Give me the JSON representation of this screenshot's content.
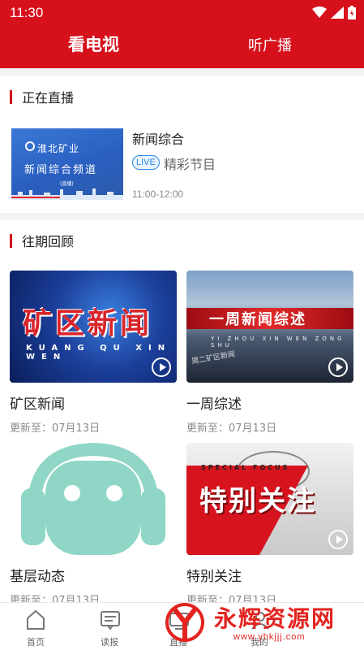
{
  "status_bar": {
    "time": "11:30"
  },
  "header": {
    "tabs": [
      {
        "label": "看电视",
        "active": true
      },
      {
        "label": "听广播",
        "active": false
      }
    ],
    "accent_color": "#d6111c"
  },
  "live_section": {
    "title": "正在直播",
    "item": {
      "title": "新闻综合",
      "badge": "LIVE",
      "program": "精彩节目",
      "time": "11:00-12:00",
      "thumb_logo": "淮北矿业",
      "thumb_channel": "新闻综合频道",
      "thumb_sub": "(直播)"
    }
  },
  "replay_section": {
    "title": "往期回顾",
    "items": [
      {
        "title": "矿区新闻",
        "update": "更新至：07月13日",
        "thumb_text": "矿区新闻",
        "thumb_pinyin": "KUANG QU XIN WEN",
        "icon": "play-icon"
      },
      {
        "title": "一周综述",
        "update": "更新至：07月13日",
        "thumb_text": "一周新闻综述",
        "thumb_pinyin": "YI ZHOU XIN WEN ZONG SHU",
        "thumb_caption": "周二矿区新闻",
        "icon": "play-icon"
      },
      {
        "title": "基层动态",
        "update": "更新至：07月13日",
        "icon": "headset-face-icon"
      },
      {
        "title": "特别关注",
        "update": "更新至：07月13日",
        "thumb_text": "特别关注",
        "thumb_label": "SPECIAL FOCUS",
        "icon": "play-icon"
      }
    ]
  },
  "bottom_nav": {
    "items": [
      {
        "label": "首页",
        "icon": "home-icon"
      },
      {
        "label": "读报",
        "icon": "newspaper-icon"
      },
      {
        "label": "直播",
        "icon": "tv-icon"
      },
      {
        "label": "我的",
        "icon": "user-icon"
      }
    ]
  },
  "watermark": {
    "text": "永辉资源网",
    "url": "www.yhkjjj.com"
  }
}
